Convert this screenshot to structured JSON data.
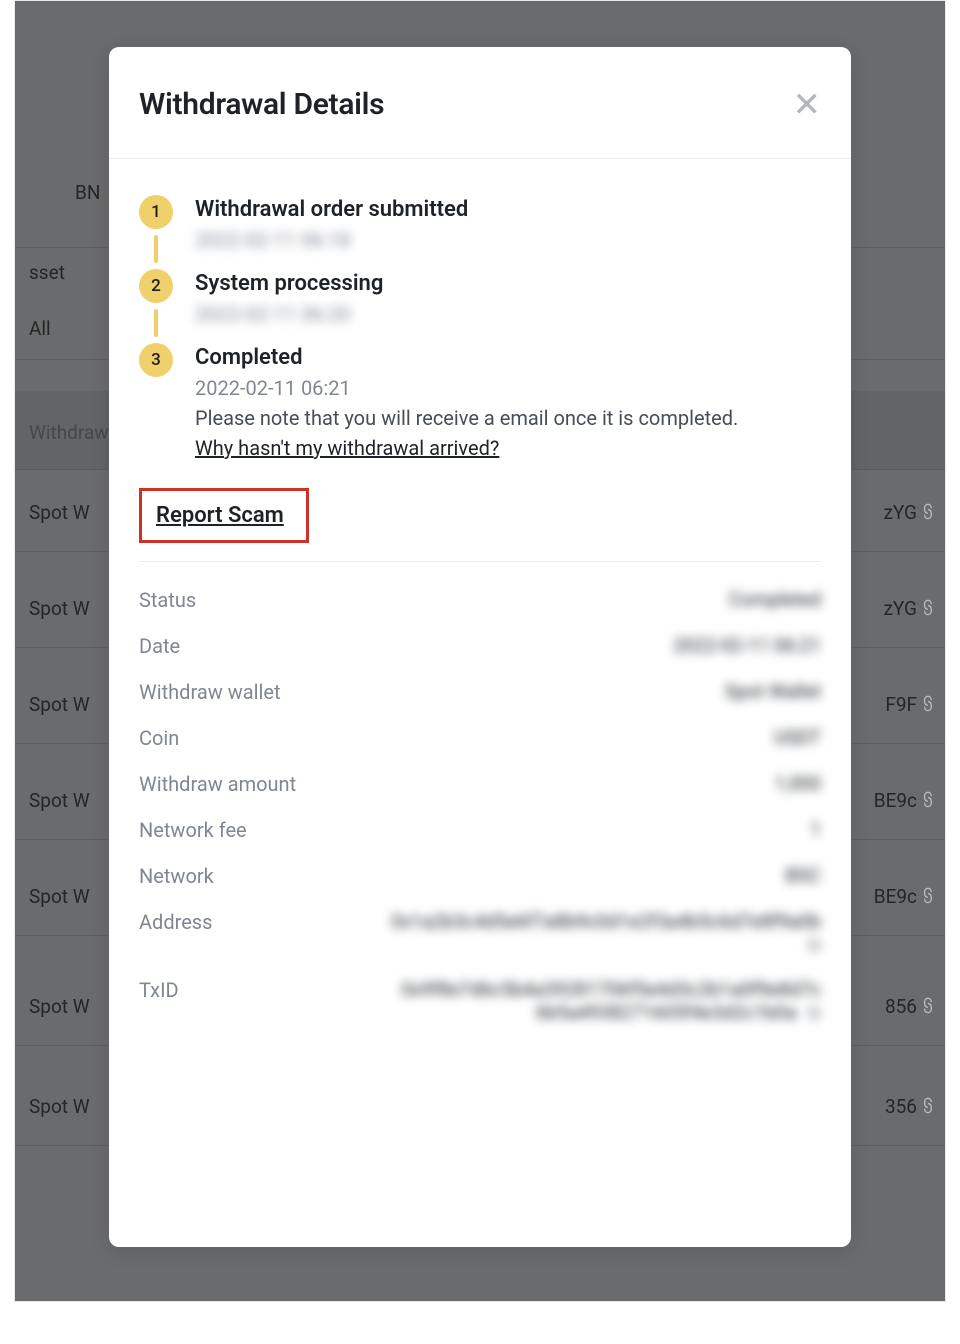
{
  "modal": {
    "title": "Withdrawal Details",
    "steps": [
      {
        "label": "Withdrawal order submitted",
        "time": "2022-02-11 06:18"
      },
      {
        "label": "System processing",
        "time": "2022-02-11 06:20"
      },
      {
        "label": "Completed",
        "time": "2022-02-11 06:21"
      }
    ],
    "completed_note": "Please note that you will receive a email once it is completed.",
    "faq_link": "Why hasn't my withdrawal arrived?",
    "report_scam": "Report Scam",
    "details": {
      "status": {
        "label": "Status",
        "value": "Completed"
      },
      "date": {
        "label": "Date",
        "value": "2022-02-11 06:21"
      },
      "withdraw_wallet": {
        "label": "Withdraw wallet",
        "value": "Spot Wallet"
      },
      "coin": {
        "label": "Coin",
        "value": "USDT"
      },
      "withdraw_amount": {
        "label": "Withdraw amount",
        "value": "1,000"
      },
      "network_fee": {
        "label": "Network fee",
        "value": "1"
      },
      "network": {
        "label": "Network",
        "value": "BSC"
      },
      "address": {
        "label": "Address",
        "value": "0x1a2b3c4d5e6f7a8b9c0d1e2f3a4b5c6d7e8f9a0b"
      },
      "txid": {
        "label": "TxID",
        "value": "0x9f8e7d6c5b4a39281706f5e4d3c2b1a0f9e8d7c6b5a4938271605f4e3d2c1b0a"
      }
    }
  },
  "background": {
    "brand_fragment": "BN",
    "header_asset": "sset",
    "header_all": "All",
    "row_withdraw": "Withdraw",
    "row_spot": "Spot W",
    "right_frag1": "zYG",
    "right_frag2": "F9F",
    "right_frag3": "BE9c",
    "right_frag4": "856",
    "right_frag5": "356"
  }
}
